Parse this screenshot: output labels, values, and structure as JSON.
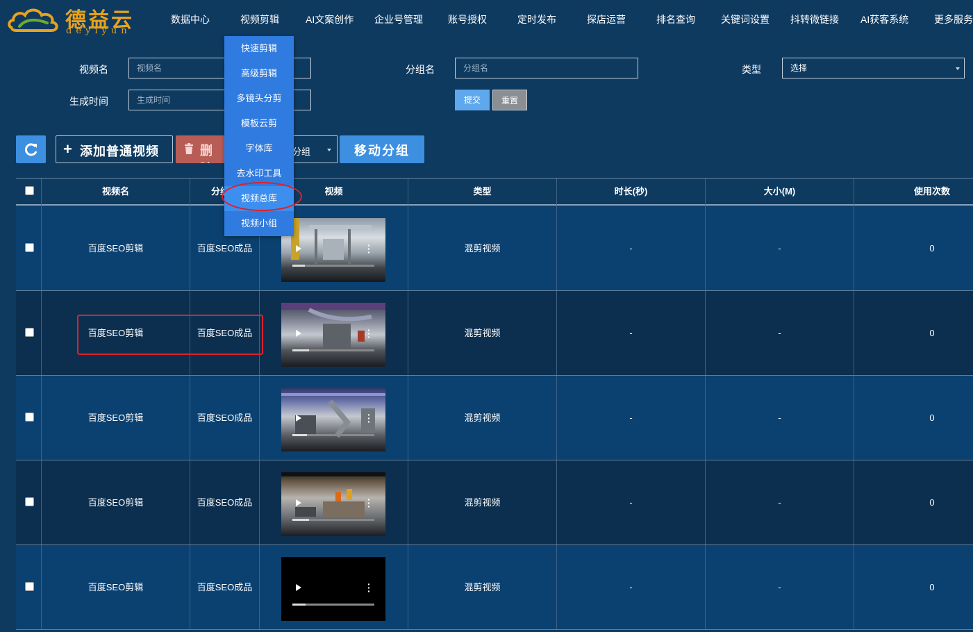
{
  "brand": {
    "name_cn": "德益云",
    "name_en": "deyiyun"
  },
  "nav": [
    {
      "label": "数据中心"
    },
    {
      "label": "视频剪辑"
    },
    {
      "label": "AI文案创作"
    },
    {
      "label": "企业号管理"
    },
    {
      "label": "账号授权"
    },
    {
      "label": "定时发布"
    },
    {
      "label": "探店运营"
    },
    {
      "label": "排名查询"
    },
    {
      "label": "关键词设置"
    },
    {
      "label": "抖转微链接"
    },
    {
      "label": "AI获客系统"
    },
    {
      "label": "更多服务"
    }
  ],
  "dropdown": {
    "items": [
      {
        "label": "快速剪辑"
      },
      {
        "label": "高级剪辑"
      },
      {
        "label": "多镜头分剪"
      },
      {
        "label": "模板云剪"
      },
      {
        "label": "字体库"
      },
      {
        "label": "去水印工具"
      },
      {
        "label": "视频总库"
      },
      {
        "label": "视频小组"
      }
    ],
    "active_index": 6
  },
  "search": {
    "video_name": {
      "label": "视频名",
      "placeholder": "视频名",
      "value": ""
    },
    "group_name": {
      "label": "分组名",
      "placeholder": "分组名",
      "value": ""
    },
    "type": {
      "label": "类型",
      "selected": "选择"
    },
    "created_time": {
      "label": "生成时间",
      "placeholder": "生成时间",
      "value": ""
    },
    "submit_label": "提交",
    "reset_label": "重置"
  },
  "actions": {
    "add_label": "添加普通视频",
    "delete_label": "删除",
    "group_select_label": "分组",
    "move_label": "移动分组"
  },
  "table": {
    "headers": [
      "视频名",
      "分组名",
      "视频",
      "类型",
      "时长(秒)",
      "大小(M)",
      "使用次数"
    ],
    "rows": [
      {
        "name": "百度SEO剪辑",
        "group": "百度SEO成品",
        "type": "混剪视频",
        "duration": "-",
        "size": "-",
        "uses": "0",
        "progress": 0.15
      },
      {
        "name": "百度SEO剪辑",
        "group": "百度SEO成品",
        "type": "混剪视频",
        "duration": "-",
        "size": "-",
        "uses": "0",
        "progress": 0.2
      },
      {
        "name": "百度SEO剪辑",
        "group": "百度SEO成品",
        "type": "混剪视频",
        "duration": "-",
        "size": "-",
        "uses": "0",
        "progress": 0.18
      },
      {
        "name": "百度SEO剪辑",
        "group": "百度SEO成品",
        "type": "混剪视频",
        "duration": "-",
        "size": "-",
        "uses": "0",
        "progress": 0.2
      },
      {
        "name": "百度SEO剪辑",
        "group": "百度SEO成品",
        "type": "混剪视频",
        "duration": "-",
        "size": "-",
        "uses": "0",
        "progress": 0.16
      }
    ]
  },
  "colors": {
    "background": "#0e3a60",
    "accent": "#3d8fdf",
    "dropdown": "#2f7be0",
    "danger": "#b85c56",
    "annotation": "#e0202a",
    "logo": "#e8a21d"
  }
}
